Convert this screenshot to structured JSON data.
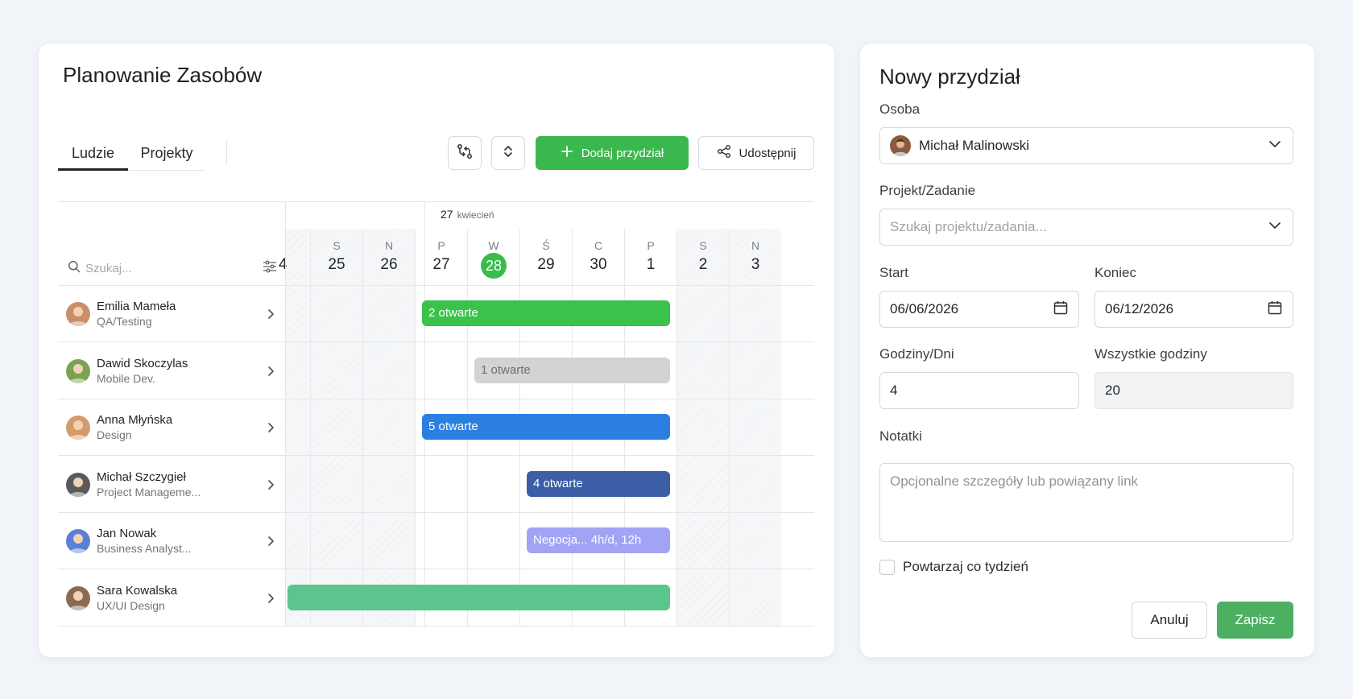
{
  "planner": {
    "title": "Planowanie Zasobów",
    "tabs": [
      {
        "label": "Ludzie",
        "active": true
      },
      {
        "label": "Projekty",
        "active": false
      }
    ],
    "toolbar": {
      "swap_icon": "swap-arrows-icon",
      "expand_icon": "expand-collapse-icon",
      "add_label": "Dodaj przydział",
      "share_label": "Udostępnij",
      "accent": "#3bb84d"
    },
    "month": {
      "day": "27",
      "name": "kwiecień"
    },
    "search_placeholder": "Szukaj...",
    "days": [
      {
        "dow": "",
        "num": "4",
        "weekend": true,
        "today": false,
        "partial": true
      },
      {
        "dow": "S",
        "num": "25",
        "weekend": true,
        "today": false
      },
      {
        "dow": "N",
        "num": "26",
        "weekend": true,
        "today": false
      },
      {
        "dow": "P",
        "num": "27",
        "weekend": false,
        "today": false
      },
      {
        "dow": "W",
        "num": "28",
        "weekend": false,
        "today": true
      },
      {
        "dow": "Ś",
        "num": "29",
        "weekend": false,
        "today": false
      },
      {
        "dow": "C",
        "num": "30",
        "weekend": false,
        "today": false
      },
      {
        "dow": "P",
        "num": "1",
        "weekend": false,
        "today": false
      },
      {
        "dow": "S",
        "num": "2",
        "weekend": true,
        "today": false
      },
      {
        "dow": "N",
        "num": "3",
        "weekend": true,
        "today": false
      }
    ],
    "people": [
      {
        "name": "Emilia Mameła",
        "role": "QA/Testing",
        "avatar_color": "#c98f6b",
        "bar": {
          "label": "2 otwarte",
          "color": "#3ac24b",
          "text_color": "#ffffff",
          "start_day": "27",
          "end_day": "1"
        }
      },
      {
        "name": "Dawid Skoczylas",
        "role": "Mobile Dev.",
        "avatar_color": "#7aa34f",
        "bar": {
          "label": "1 otwarte",
          "color": "#d3d3d3",
          "text_color": "#6d6f73",
          "start_day": "28",
          "end_day": "1"
        }
      },
      {
        "name": "Anna Młyńska",
        "role": "Design",
        "avatar_color": "#d59a6a",
        "bar": {
          "label": "5 otwarte",
          "color": "#2a7fe0",
          "text_color": "#ffffff",
          "start_day": "27",
          "end_day": "1"
        }
      },
      {
        "name": "Michał Szczygieł",
        "role": "Project Manageme...",
        "avatar_color": "#5a5a5a",
        "bar": {
          "label": "4 otwarte",
          "color": "#3b5ea6",
          "text_color": "#ffffff",
          "start_day": "29",
          "end_day": "1"
        }
      },
      {
        "name": "Jan Nowak",
        "role": "Business Analyst...",
        "avatar_color": "#5b7fd6",
        "bar": {
          "label": "Negocja... 4h/d, 12h",
          "color": "#a3a3f5",
          "text_color": "#ffffff",
          "start_day": "29",
          "end_day": "1"
        }
      },
      {
        "name": "Sara Kowalska",
        "role": "UX/UI Design",
        "avatar_color": "#8a6a52",
        "bar": {
          "label": "",
          "color": "#5cc58e",
          "text_color": "#ffffff",
          "start_day": "4",
          "end_day": "1"
        }
      }
    ]
  },
  "form": {
    "title": "Nowy przydział",
    "person_label": "Osoba",
    "person_value": "Michał Malinowski",
    "project_label": "Projekt/Zadanie",
    "project_placeholder": "Szukaj projektu/zadania...",
    "start_label": "Start",
    "start_value": "06/06/2026",
    "end_label": "Koniec",
    "end_value": "06/12/2026",
    "hours_label": "Godziny/Dni",
    "hours_value": "4",
    "total_label": "Wszystkie godziny",
    "total_value": "20",
    "notes_label": "Notatki",
    "notes_placeholder": "Opcjonalne szczegóły lub powiązany link",
    "repeat_label": "Powtarzaj co tydzień",
    "repeat_checked": false,
    "cancel_label": "Anuluj",
    "save_label": "Zapisz",
    "save_color": "#4caf62"
  }
}
